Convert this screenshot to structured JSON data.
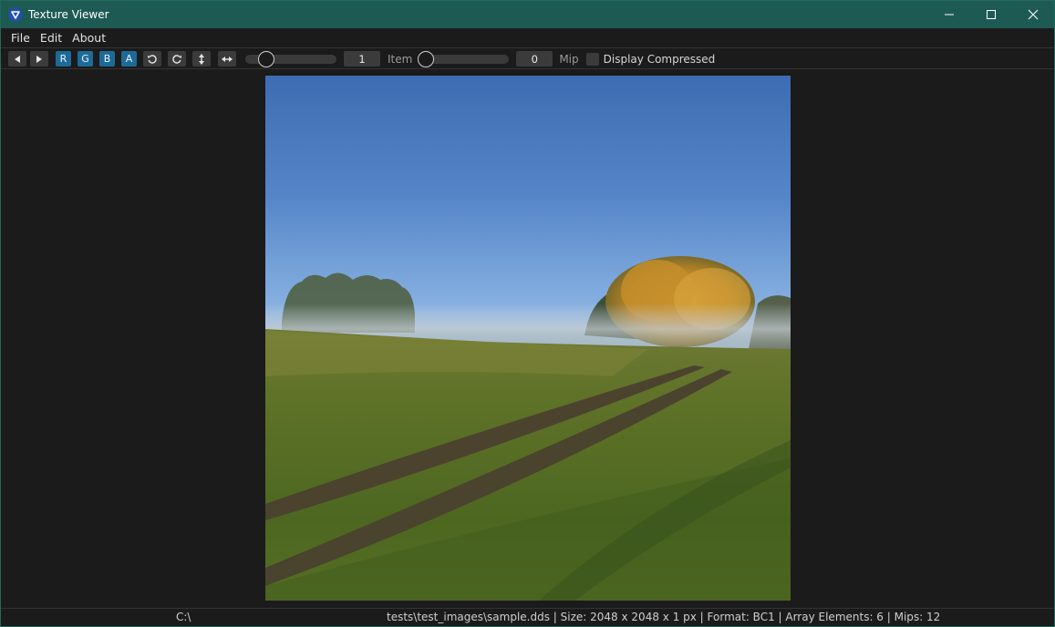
{
  "window": {
    "title": "Texture Viewer",
    "accent_color": "#1e5a54",
    "controls": [
      "minimize-icon",
      "maximize-icon",
      "close-icon"
    ]
  },
  "menu": {
    "items": [
      "File",
      "Edit",
      "About"
    ]
  },
  "toolbar": {
    "prev_icon": "triangle-left-icon",
    "next_icon": "triangle-right-icon",
    "channels": [
      "R",
      "G",
      "B",
      "A"
    ],
    "channel_color": "#1d6a98",
    "rotate_ccw_icon": "rotate-ccw-icon",
    "rotate_cw_icon": "rotate-cw-icon",
    "flip_vertical_icon": "flip-vertical-icon",
    "flip_horizontal_icon": "flip-horizontal-icon",
    "item_slider_fraction": 0.0,
    "item_value": "1",
    "item_label": "Item",
    "mip_slider_fraction": 0.0,
    "mip_value": "0",
    "mip_label": "Mip",
    "display_compressed_label": "Display Compressed",
    "display_compressed_checked": false
  },
  "viewer": {
    "image_description_icon": "texture-image"
  },
  "status": {
    "drive": "C:\\",
    "path_tail": "tests\\test_images\\sample.dds | Size: 2048 x 2048 x 1 px | Format: BC1 | Array Elements: 6 | Mips: 12"
  }
}
